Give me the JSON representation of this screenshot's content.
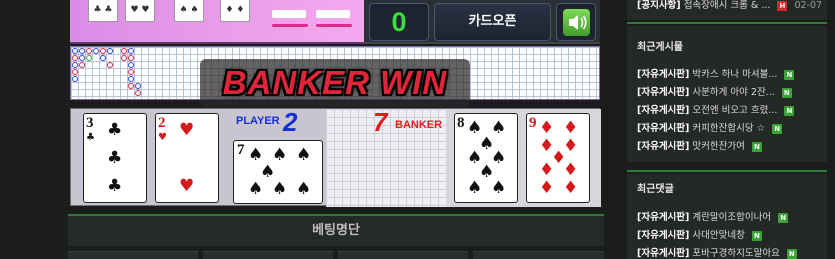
{
  "game": {
    "score": "0",
    "card_open_label": "카드오픈",
    "result_banner": "BANKER WIN",
    "player_label": "PLAYER",
    "player_score": "2",
    "banker_score": "7",
    "banker_label": "BANKER",
    "player_cards": [
      {
        "rank": "3",
        "suit": "♣",
        "color": "black"
      },
      {
        "rank": "2",
        "suit": "♥",
        "color": "red"
      },
      {
        "rank": "7",
        "suit": "♠",
        "color": "black"
      }
    ],
    "banker_cards": [
      {
        "rank": "8",
        "suit": "♠",
        "color": "black"
      },
      {
        "rank": "9",
        "suit": "♦",
        "color": "red"
      }
    ],
    "betting_header": "베팅명단"
  },
  "sidebar": {
    "top_row": {
      "category": "[공지사항]",
      "title": "접속장애시 크롬 & ...",
      "badge": "H",
      "date": "02-07"
    },
    "recent_posts": {
      "title": "최근게시물",
      "items": [
        {
          "category": "[자유게시판]",
          "title": "박카스 하나 마셔볼...",
          "badge": "N"
        },
        {
          "category": "[자유게시판]",
          "title": "사분하게 아야 2잔...",
          "badge": "N"
        },
        {
          "category": "[자유게시판]",
          "title": "오전엔 비오고 흐렸...",
          "badge": "N"
        },
        {
          "category": "[자유게시판]",
          "title": "커피한잔합시당 ☆",
          "badge": "N"
        },
        {
          "category": "[자유게시판]",
          "title": "맛커한잔가여",
          "badge": "N"
        }
      ]
    },
    "recent_comments": {
      "title": "최근댓글",
      "items": [
        {
          "category": "[자유게시판]",
          "title": "계란말이조합이나어",
          "badge": "N"
        },
        {
          "category": "[자유게시판]",
          "title": "사대안맞네창",
          "badge": "N"
        },
        {
          "category": "[자유게시판]",
          "title": "포바구경하지도말아요",
          "badge": "N"
        }
      ]
    }
  },
  "colors": {
    "accent_green": "#2b7c40",
    "player_blue": "#1530d8",
    "banker_red": "#e31d1d",
    "score_green": "#3bdc3b",
    "new_badge": "#3aa335"
  },
  "icons": {
    "sound": "speaker-icon"
  }
}
